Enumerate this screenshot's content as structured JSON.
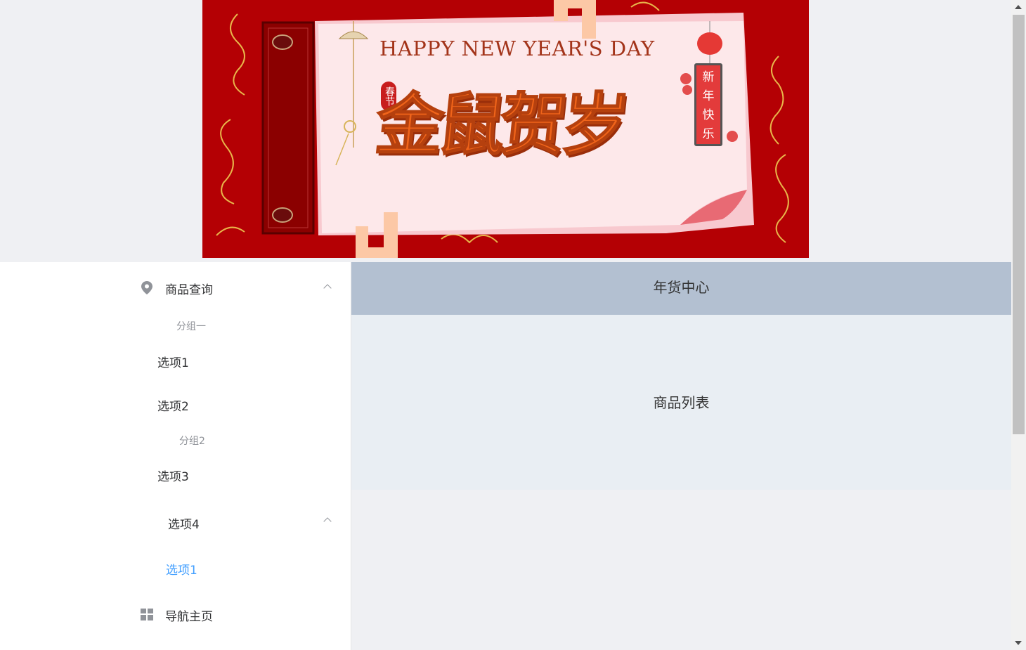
{
  "banner": {
    "headline": "HAPPY NEW YEAR'S DAY",
    "main_title": "金鼠贺岁",
    "seal_text": "春节",
    "vertical_text": [
      "新",
      "年",
      "快",
      "乐"
    ]
  },
  "sidebar": {
    "menu1": {
      "title": "商品查询",
      "icon": "location-icon",
      "expanded": true,
      "groups": [
        {
          "title": "分组一",
          "items": [
            "选项1",
            "选项2"
          ]
        },
        {
          "title": "分组2",
          "items": [
            "选项3"
          ]
        }
      ],
      "submenu": {
        "title": "选项4",
        "expanded": true,
        "items": [
          "选项1"
        ]
      }
    },
    "menu2": {
      "title": "导航主页",
      "icon": "menu-grid-icon"
    }
  },
  "header": {
    "title": "年货中心"
  },
  "main": {
    "content": "商品列表"
  },
  "colors": {
    "header_bg": "#b3c0d1",
    "main_bg": "#e9eef3",
    "active": "#409eff",
    "banner_bg": "#b40004"
  }
}
